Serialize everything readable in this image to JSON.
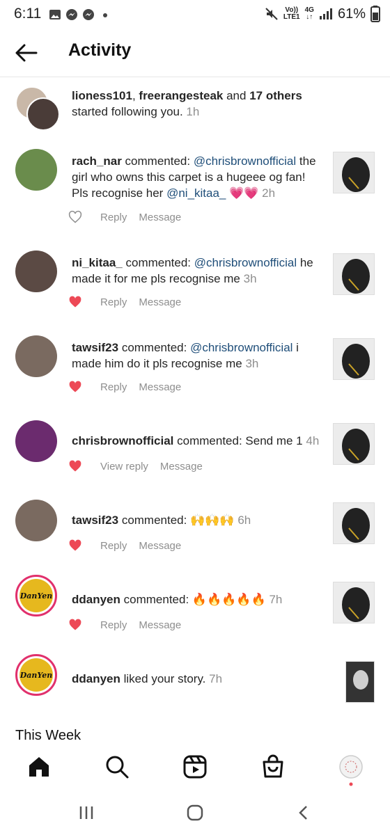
{
  "status": {
    "time": "6:11",
    "net_top": "Vo))",
    "net_bottom": "LTE1",
    "net_type": "4G",
    "battery": "61%"
  },
  "header": {
    "title": "Activity"
  },
  "rows": [
    {
      "parts": [
        [
          "b",
          "lioness101"
        ],
        [
          "t",
          ", "
        ],
        [
          "b",
          "freerangesteak"
        ],
        [
          "t",
          " and "
        ],
        [
          "b",
          "17 others"
        ],
        [
          "t",
          " started following you. "
        ]
      ],
      "time": "1h",
      "thumb": false
    },
    {
      "parts": [
        [
          "b",
          "rach_nar"
        ],
        [
          "t",
          " commented: "
        ],
        [
          "m",
          "@chrisbrownofficial"
        ],
        [
          "t",
          " the girl who owns this carpet is a hugeee og fan! Pls recognise her "
        ],
        [
          "m",
          "@ni_kitaa_"
        ],
        [
          "t",
          " 💗💗 "
        ]
      ],
      "time": "2h",
      "liked": false,
      "reply": "Reply",
      "message": "Message"
    },
    {
      "parts": [
        [
          "b",
          "ni_kitaa_"
        ],
        [
          "t",
          " commented: "
        ],
        [
          "m",
          "@chrisbrownofficial"
        ],
        [
          "t",
          " he made it for me pls recognise me "
        ]
      ],
      "time": "3h",
      "liked": true,
      "reply": "Reply",
      "message": "Message"
    },
    {
      "parts": [
        [
          "b",
          "tawsif23"
        ],
        [
          "t",
          " commented: "
        ],
        [
          "m",
          "@chrisbrownofficial"
        ],
        [
          "t",
          " i made him do it pls recognise me "
        ]
      ],
      "time": "3h",
      "liked": true,
      "reply": "Reply",
      "message": "Message"
    },
    {
      "parts": [
        [
          "b",
          "chrisbrownofficial"
        ],
        [
          "t",
          " commented: Send me 1 "
        ]
      ],
      "time": "4h",
      "liked": true,
      "reply": "View reply",
      "message": "Message"
    },
    {
      "parts": [
        [
          "b",
          "tawsif23"
        ],
        [
          "t",
          " commented: 🙌🙌🙌 "
        ]
      ],
      "time": "6h",
      "liked": true,
      "reply": "Reply",
      "message": "Message"
    },
    {
      "parts": [
        [
          "b",
          "ddanyen"
        ],
        [
          "t",
          " commented: 🔥🔥🔥🔥🔥 "
        ]
      ],
      "time": "7h",
      "liked": true,
      "reply": "Reply",
      "message": "Message"
    },
    {
      "parts": [
        [
          "b",
          "ddanyen"
        ],
        [
          "t",
          " liked your story. "
        ]
      ],
      "time": "7h"
    }
  ],
  "section_label": "This Week",
  "avatar_text": "DanYen",
  "colors": {
    "heart_red": "#ed4956",
    "mention": "#1f4e79",
    "muted": "#8e8e8e",
    "ring": "#e1306c"
  },
  "nav": [
    "home-icon",
    "search-icon",
    "reels-icon",
    "shop-icon",
    "profile-icon"
  ]
}
